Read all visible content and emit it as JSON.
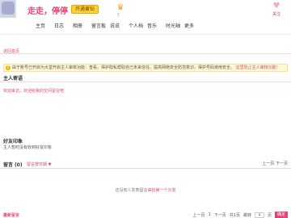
{
  "header": {
    "site_title": "走走，停停",
    "vip_label": "开通黄钻",
    "follow_label": "关注",
    "accent_color": "#e0457a"
  },
  "nav": {
    "items": [
      "主页",
      "日志",
      "相册",
      "留言板",
      "说说",
      "个人档",
      "音乐",
      "时光轴",
      "更多"
    ]
  },
  "home_link": "返回首页",
  "notice": {
    "icon": "warning-icon",
    "text": "由于账号已开启为大堂开启主人审核功能：查看，保护隐私帮助自己未来信任。提高网络安全防范意识，保护号码使用安全。",
    "link": "这里防止主人审核功能！"
  },
  "main": {
    "title": "主人寄语",
    "welcome": "欢迎来访，欢迎给我的空间留言吧"
  },
  "impression": {
    "title": "好友印象",
    "text": "主人暂时没有收到好友印象"
  },
  "comments": {
    "title_prefix": "留言",
    "count": "(0)",
    "filter": "留言按日期 ▼",
    "pager": "上一页  下一页",
    "empty_text": "还没有人发表留言",
    "empty_link": "来抢第一个沙发"
  },
  "footer": {
    "recent_title": "最新留言",
    "first": "上一页",
    "page": "1",
    "next": "下一页",
    "total": "共1页",
    "jump_label": "跳转",
    "jump_value": "1",
    "jump_unit": "页",
    "go_button": "确定"
  }
}
